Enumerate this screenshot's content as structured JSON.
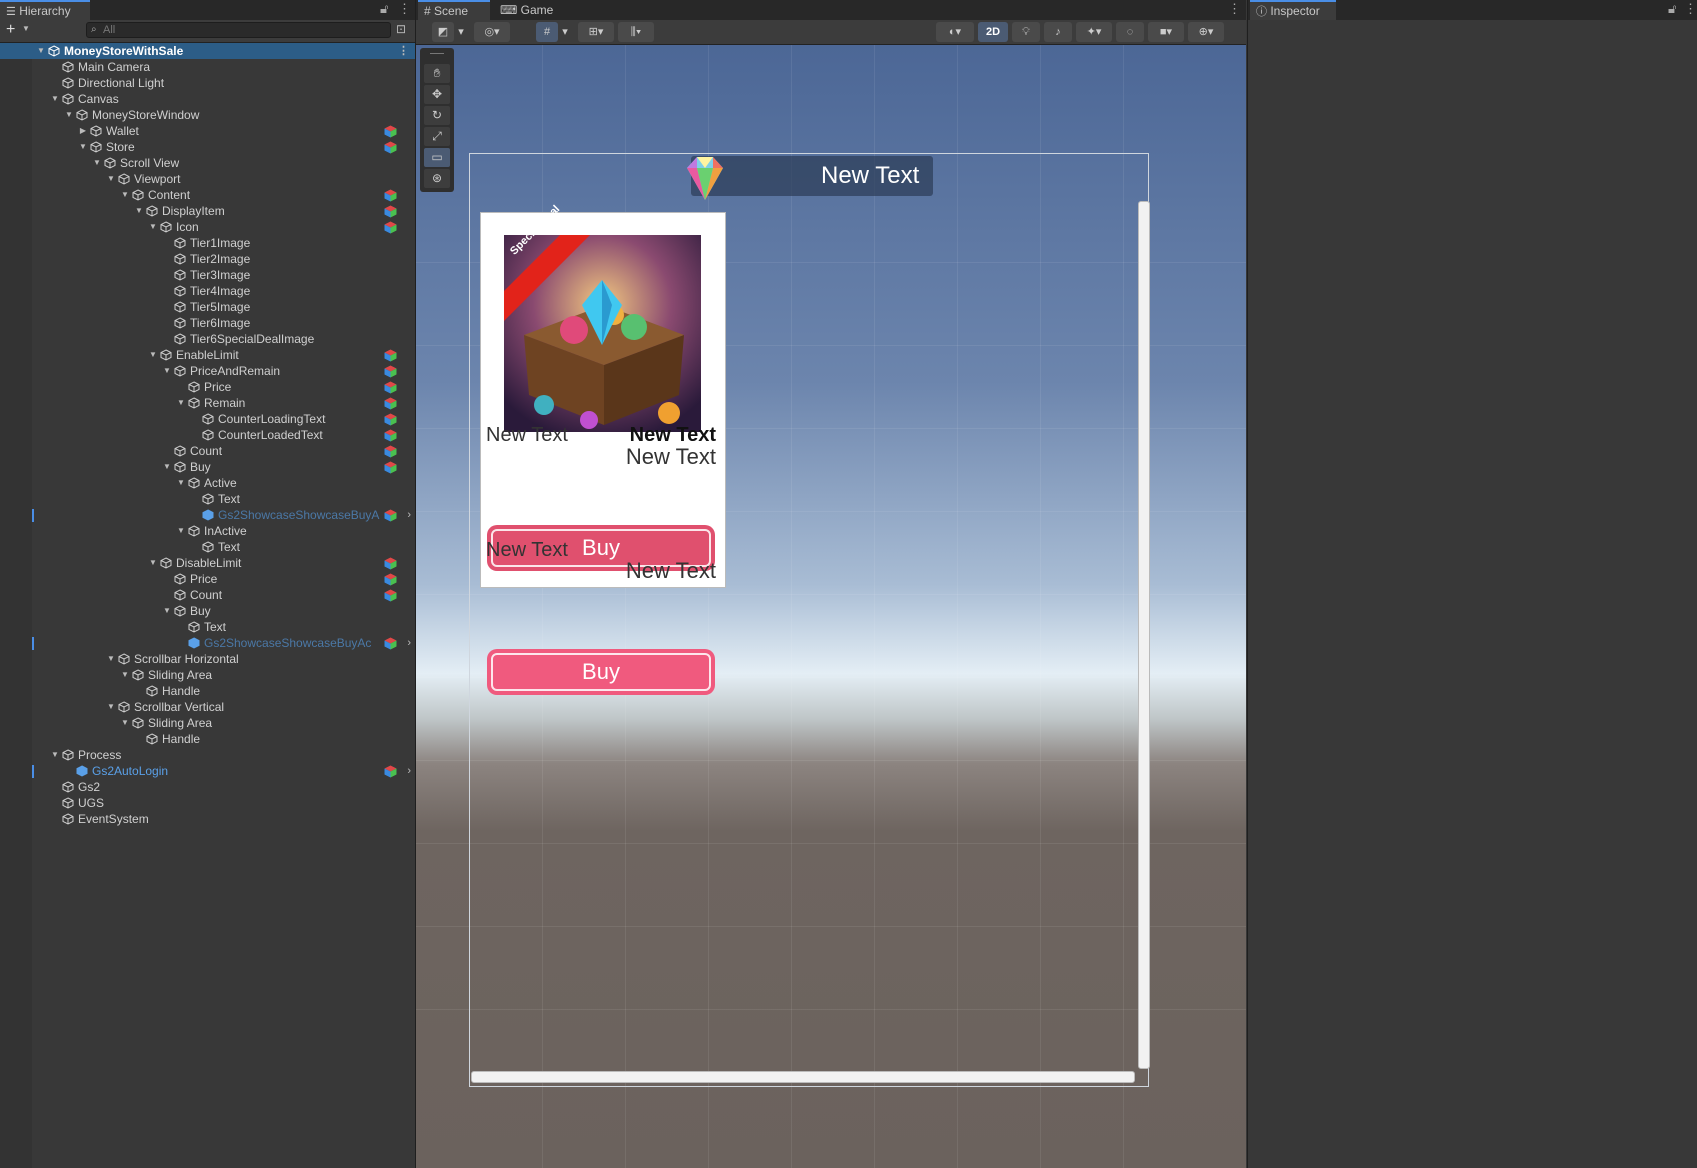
{
  "hierarchy": {
    "tab_label": "Hierarchy",
    "search_placeholder": "All",
    "rows": [
      {
        "label": "MoneyStoreWithSale",
        "indent": 0,
        "fold": "open",
        "root": true
      },
      {
        "label": "Main Camera",
        "indent": 1
      },
      {
        "label": "Directional Light",
        "indent": 1
      },
      {
        "label": "Canvas",
        "indent": 1,
        "fold": "open"
      },
      {
        "label": "MoneyStoreWindow",
        "indent": 2,
        "fold": "open"
      },
      {
        "label": "Wallet",
        "indent": 3,
        "fold": "closed",
        "multi": true
      },
      {
        "label": "Store",
        "indent": 3,
        "fold": "open",
        "multi": true
      },
      {
        "label": "Scroll View",
        "indent": 4,
        "fold": "open"
      },
      {
        "label": "Viewport",
        "indent": 5,
        "fold": "open"
      },
      {
        "label": "Content",
        "indent": 6,
        "fold": "open",
        "multi": true
      },
      {
        "label": "DisplayItem",
        "indent": 7,
        "fold": "open",
        "multi": true
      },
      {
        "label": "Icon",
        "indent": 8,
        "fold": "open",
        "multi": true
      },
      {
        "label": "Tier1Image",
        "indent": 9
      },
      {
        "label": "Tier2Image",
        "indent": 9
      },
      {
        "label": "Tier3Image",
        "indent": 9
      },
      {
        "label": "Tier4Image",
        "indent": 9
      },
      {
        "label": "Tier5Image",
        "indent": 9
      },
      {
        "label": "Tier6Image",
        "indent": 9
      },
      {
        "label": "Tier6SpecialDealImage",
        "indent": 9
      },
      {
        "label": "EnableLimit",
        "indent": 8,
        "fold": "open",
        "multi": true
      },
      {
        "label": "PriceAndRemain",
        "indent": 9,
        "fold": "open",
        "multi": true
      },
      {
        "label": "Price",
        "indent": 10,
        "multi": true
      },
      {
        "label": "Remain",
        "indent": 10,
        "fold": "open",
        "multi": true
      },
      {
        "label": "CounterLoadingText",
        "indent": 11,
        "multi": true
      },
      {
        "label": "CounterLoadedText",
        "indent": 11,
        "multi": true
      },
      {
        "label": "Count",
        "indent": 9,
        "multi": true
      },
      {
        "label": "Buy",
        "indent": 9,
        "fold": "open",
        "multi": true
      },
      {
        "label": "Active",
        "indent": 10,
        "fold": "open"
      },
      {
        "label": "Text",
        "indent": 11
      },
      {
        "label": "Gs2ShowcaseShowcaseBuyA",
        "indent": 11,
        "prefab": "dim",
        "multi": true,
        "arrow": true,
        "marker": true
      },
      {
        "label": "InActive",
        "indent": 10,
        "fold": "open"
      },
      {
        "label": "Text",
        "indent": 11
      },
      {
        "label": "DisableLimit",
        "indent": 8,
        "fold": "open",
        "multi": true
      },
      {
        "label": "Price",
        "indent": 9,
        "multi": true
      },
      {
        "label": "Count",
        "indent": 9,
        "multi": true
      },
      {
        "label": "Buy",
        "indent": 9,
        "fold": "open"
      },
      {
        "label": "Text",
        "indent": 10
      },
      {
        "label": "Gs2ShowcaseShowcaseBuyAc",
        "indent": 10,
        "prefab": "dim",
        "multi": true,
        "arrow": true,
        "marker": true
      },
      {
        "label": "Scrollbar Horizontal",
        "indent": 5,
        "fold": "open"
      },
      {
        "label": "Sliding Area",
        "indent": 6,
        "fold": "open"
      },
      {
        "label": "Handle",
        "indent": 7
      },
      {
        "label": "Scrollbar Vertical",
        "indent": 5,
        "fold": "open"
      },
      {
        "label": "Sliding Area",
        "indent": 6,
        "fold": "open"
      },
      {
        "label": "Handle",
        "indent": 7
      },
      {
        "label": "Process",
        "indent": 1,
        "fold": "open"
      },
      {
        "label": "Gs2AutoLogin",
        "indent": 2,
        "prefab": "bright",
        "multi": true,
        "arrow": true,
        "marker": true
      },
      {
        "label": "Gs2",
        "indent": 1
      },
      {
        "label": "UGS",
        "indent": 1
      },
      {
        "label": "EventSystem",
        "indent": 1
      }
    ]
  },
  "scene": {
    "tabs": [
      {
        "label": "Scene",
        "icon": "grid-icon"
      },
      {
        "label": "Game",
        "icon": "gamepad-icon"
      }
    ],
    "toolbar_2d_label": "2D",
    "wallet_text": "New Text",
    "card": {
      "ribbon": "Special Deal",
      "price_left": "New Text",
      "price_right": "New Text",
      "remain": "New Text",
      "buy_label": "Buy"
    },
    "disabled": {
      "price": "New Text",
      "count": "New Text",
      "buy_label": "Buy"
    }
  },
  "inspector": {
    "tab_label": "Inspector"
  },
  "colors": {
    "selection": "#2c5d87",
    "prefab_blue": "#5aa0e8",
    "buy_active": "#e0506e",
    "buy_inactive": "#f05a7e"
  }
}
